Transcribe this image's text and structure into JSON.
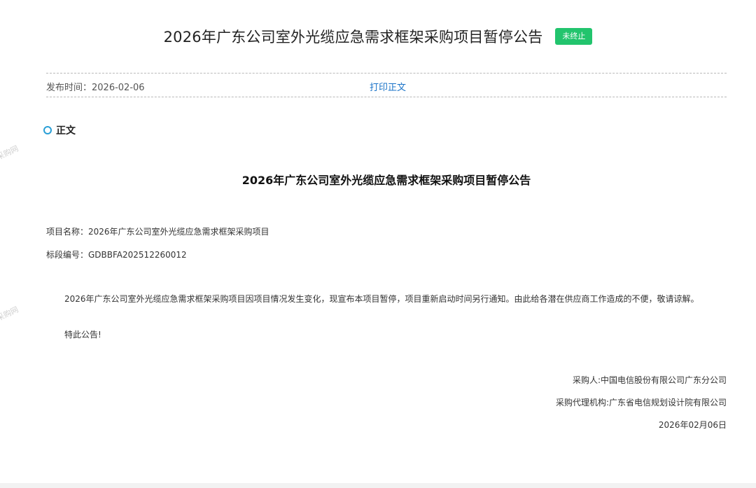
{
  "header": {
    "title": "2026年广东公司室外光缆应急需求框架采购项目暂停公告",
    "status_badge": "未终止"
  },
  "meta": {
    "publish_time": "发布时间：2026-02-06",
    "print_link": "打印正文"
  },
  "section": {
    "label": "正文"
  },
  "document": {
    "title": "2026年广东公司室外光缆应急需求框架采购项目暂停公告",
    "project_name": "项目名称：2026年广东公司室外光缆应急需求框架采购项目",
    "section_code": "标段编号：GDBBFA202512260012",
    "body": "2026年广东公司室外光缆应急需求框架采购项目因项目情况发生变化，现宣布本项目暂停，项目重新启动时间另行通知。由此给各潜在供应商工作造成的不便，敬请谅解。",
    "notice": "特此公告!",
    "buyer": "采购人:中国电信股份有限公司广东分公司",
    "agent": "采购代理机构:广东省电信规划设计院有限公司",
    "date": "2026年02月06日"
  },
  "watermark": {
    "text": "采购网"
  },
  "colors": {
    "badge": "#22c46d",
    "link": "#1a73c8",
    "bullet": "#2a9fd6"
  }
}
